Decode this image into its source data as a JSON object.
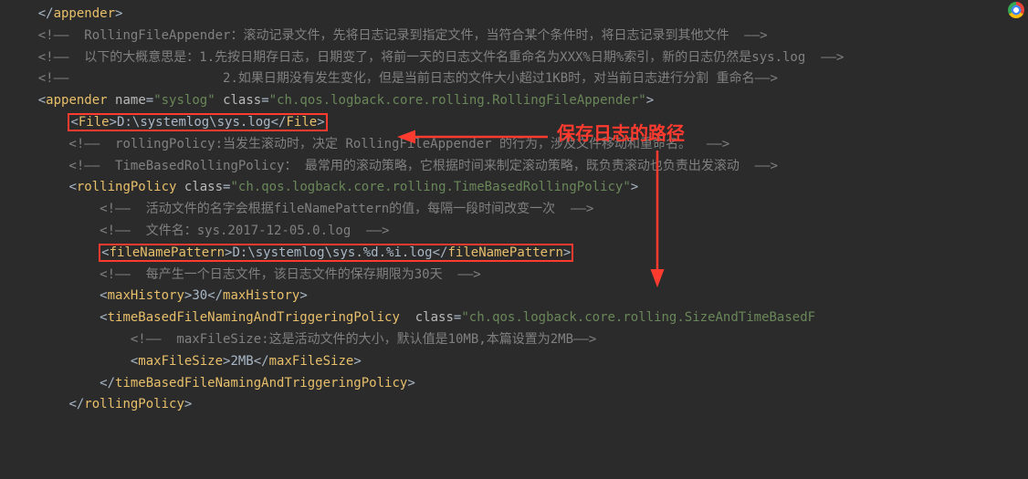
{
  "annotation": {
    "label": "保存日志的路径"
  },
  "code": {
    "l1": {
      "close_appender": "appender"
    },
    "l2": {
      "comment": "  RollingFileAppender：滚动记录文件，先将日志记录到指定文件，当符合某个条件时，将日志记录到其他文件  "
    },
    "l3": {
      "comment": "  以下的大概意思是：1.先按日期存日志，日期变了，将前一天的日志文件名重命名为XXX%日期%索引，新的日志仍然是sys.log  "
    },
    "l4": {
      "comment": "                    2.如果日期没有发生变化，但是当前日志的文件大小超过1KB时，对当前日志进行分割 重命名"
    },
    "l5": {
      "tag": "appender",
      "attr1_name": "name",
      "attr1_val": "syslog",
      "attr2_name": "class",
      "attr2_val": "ch.qos.logback.core.rolling.RollingFileAppender"
    },
    "l6": {
      "tag": "File",
      "text": "D:\\systemlog\\sys.log"
    },
    "l7": {
      "comment": "  rollingPolicy:当发生滚动时，决定 RollingFileAppender 的行为，涉及文件移动和重命名。  "
    },
    "l8": {
      "comment": "  TimeBasedRollingPolicy： 最常用的滚动策略，它根据时间来制定滚动策略，既负责滚动也负责出发滚动  "
    },
    "l9": {
      "tag": "rollingPolicy",
      "attr1_name": "class",
      "attr1_val": "ch.qos.logback.core.rolling.TimeBasedRollingPolicy"
    },
    "l10": {
      "comment": "  活动文件的名字会根据fileNamePattern的值，每隔一段时间改变一次  "
    },
    "l11": {
      "comment": "  文件名：sys.2017-12-05.0.log  "
    },
    "l12": {
      "tag": "fileNamePattern",
      "text": "D:\\systemlog\\sys.%d.%i.log"
    },
    "l13": {
      "comment": "  每产生一个日志文件，该日志文件的保存期限为30天  "
    },
    "l14": {
      "tag": "maxHistory",
      "text": "30"
    },
    "l15": {
      "tag": "timeBasedFileNamingAndTriggeringPolicy",
      "attr1_name": "class",
      "attr1_val": "ch.qos.logback.core.rolling.SizeAndTimeBasedF"
    },
    "l16": {
      "comment": "  maxFileSize:这是活动文件的大小，默认值是10MB,本篇设置为2MB"
    },
    "l17": {
      "tag": "maxFileSize",
      "text": "2MB"
    },
    "l18": {
      "close_tag": "timeBasedFileNamingAndTriggeringPolicy"
    },
    "l19": {
      "close_tag": "rollingPolicy"
    }
  }
}
